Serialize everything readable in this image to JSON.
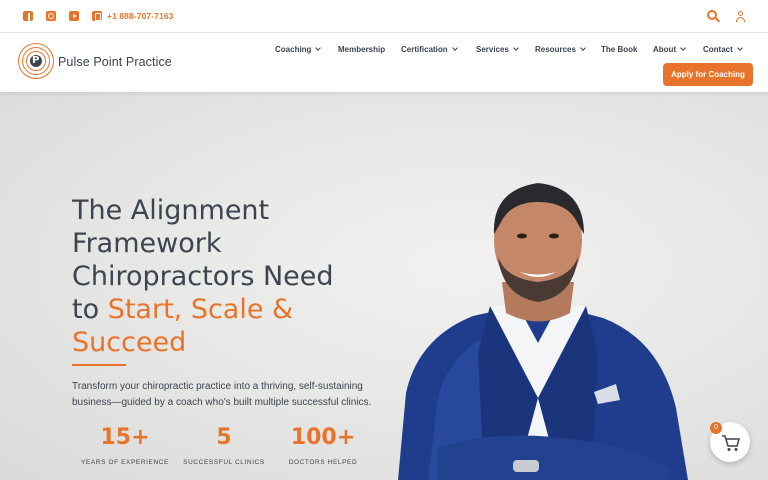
{
  "topbar": {
    "phone": "+1 888-707-7163",
    "icons": [
      "facebook-icon",
      "instagram-icon",
      "youtube-icon",
      "phone-icon",
      "search-icon",
      "user-icon"
    ]
  },
  "brand": {
    "name": "Pulse Point Practice",
    "mark_letter": "P"
  },
  "nav": {
    "items": [
      {
        "label": "Coaching",
        "dropdown": true
      },
      {
        "label": "Membership",
        "dropdown": false
      },
      {
        "label": "Certification",
        "dropdown": true
      },
      {
        "label": "Services",
        "dropdown": true
      },
      {
        "label": "Resources",
        "dropdown": true
      },
      {
        "label": "The Book",
        "dropdown": false
      },
      {
        "label": "About",
        "dropdown": true
      },
      {
        "label": "Contact",
        "dropdown": true
      }
    ],
    "cta_label": "Apply for Coaching"
  },
  "hero": {
    "headline_lines": [
      "The Alignment",
      "Framework",
      "Chiropractors Need",
      "to "
    ],
    "headline_highlight_1": "Start, Scale &",
    "headline_highlight_2": "Succeed",
    "subtext": "Transform your chiropractic practice into a thriving, self-sustaining business—guided by a coach who's built multiple successful clinics.",
    "stats": [
      {
        "value": "15+",
        "label": "YEARS OF EXPERIENCE"
      },
      {
        "value": "5",
        "label": "SUCCESSFUL CLINICS"
      },
      {
        "value": "100+",
        "label": "DOCTORS HELPED"
      }
    ]
  },
  "cart": {
    "count": "0"
  },
  "colors": {
    "accent": "#e8742c",
    "text": "#3d4450"
  }
}
